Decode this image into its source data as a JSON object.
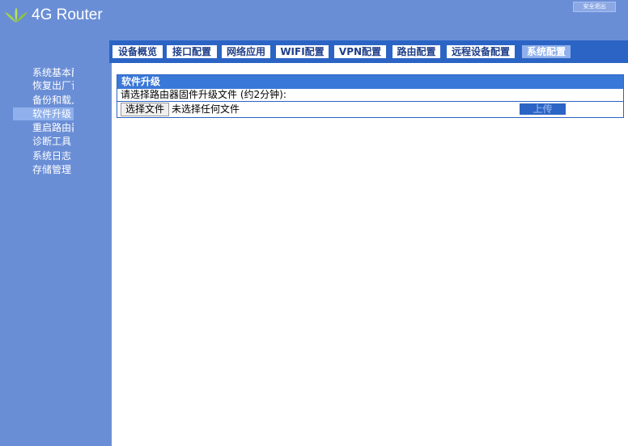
{
  "header": {
    "logo_text": "4G Router",
    "logout_label": "安全退出"
  },
  "nav": {
    "tabs": [
      {
        "label": "设备概览",
        "active": false
      },
      {
        "label": "接口配置",
        "active": false
      },
      {
        "label": "网络应用",
        "active": false
      },
      {
        "label": "WIFI配置",
        "active": false
      },
      {
        "label": "VPN配置",
        "active": false
      },
      {
        "label": "路由配置",
        "active": false
      },
      {
        "label": "远程设备配置",
        "active": false
      },
      {
        "label": "系统配置",
        "active": true
      }
    ]
  },
  "sidebar": {
    "items": [
      {
        "label": "系统基本配",
        "active": false
      },
      {
        "label": "恢复出厂设",
        "active": false
      },
      {
        "label": "备份和载入",
        "active": false
      },
      {
        "label": "软件升级",
        "active": true
      },
      {
        "label": "重启路由器",
        "active": false
      },
      {
        "label": "诊断工具",
        "active": false
      },
      {
        "label": "系统日志",
        "active": false
      },
      {
        "label": "存储管理",
        "active": false
      }
    ]
  },
  "panel": {
    "title": "软件升级",
    "description": "请选择路由器固件升级文件 (约2分钟):",
    "file_button_label": "选择文件",
    "file_status": "未选择任何文件",
    "upload_label": "上传"
  },
  "colors": {
    "brand_blue": "#6a8ed6",
    "nav_blue": "#2b64c4",
    "panel_title_blue": "#3a78d8",
    "active_highlight": "#8fb0ec"
  }
}
